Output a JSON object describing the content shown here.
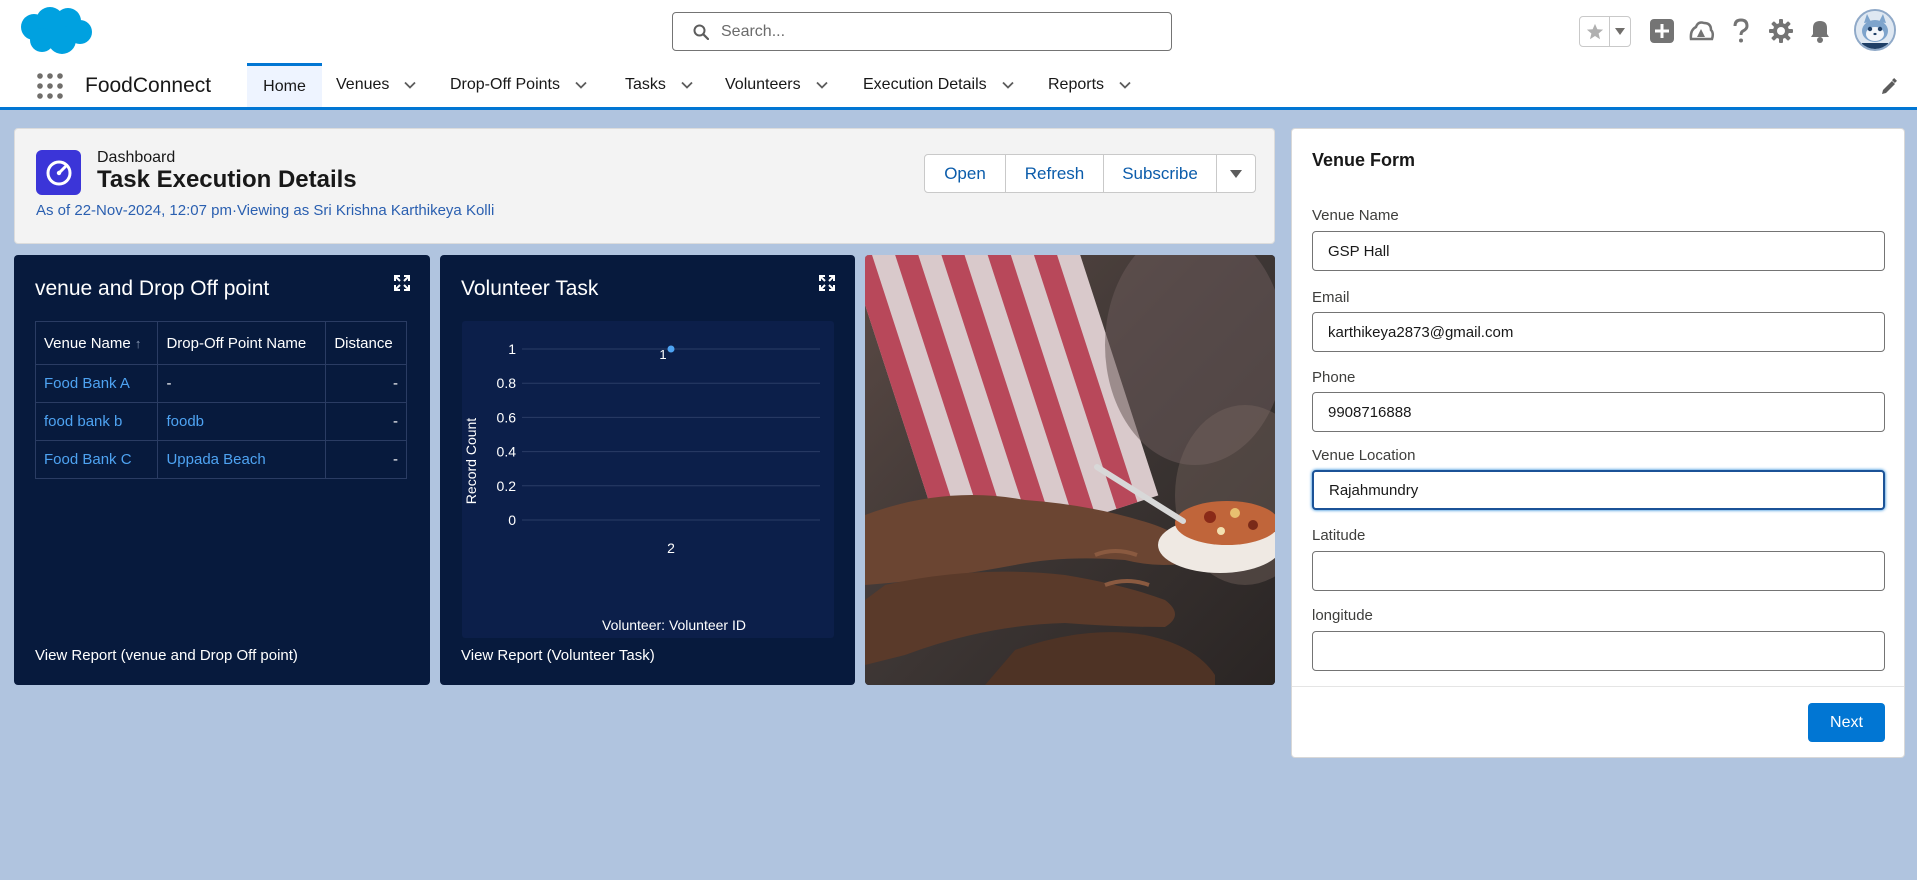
{
  "header": {
    "search_placeholder": "Search...",
    "icons": [
      "favorites-star-icon",
      "favorites-dropdown-icon",
      "global-actions-icon",
      "trailhead-icon",
      "help-icon",
      "setup-gear-icon",
      "notifications-bell-icon",
      "user-avatar"
    ]
  },
  "nav": {
    "app_name": "FoodConnect",
    "tabs": [
      {
        "label": "Home",
        "active": true
      },
      {
        "label": "Venues"
      },
      {
        "label": "Drop-Off Points"
      },
      {
        "label": "Tasks"
      },
      {
        "label": "Volunteers"
      },
      {
        "label": "Execution Details"
      },
      {
        "label": "Reports"
      }
    ]
  },
  "dashboard": {
    "type_label": "Dashboard",
    "title": "Task Execution Details",
    "meta": "As of 22-Nov-2024, 12:07 pm·Viewing as Sri Krishna Karthikeya Kolli",
    "actions": {
      "open": "Open",
      "refresh": "Refresh",
      "subscribe": "Subscribe"
    }
  },
  "widget_venue": {
    "title": "venue and Drop Off point",
    "columns": [
      "Venue Name",
      "Drop-Off Point Name",
      "Distance"
    ],
    "sort_indicator": "↑",
    "rows": [
      {
        "venue": "Food Bank A",
        "dropoff": "-",
        "distance": "-"
      },
      {
        "venue": "food bank b",
        "dropoff": "foodb",
        "distance": "-"
      },
      {
        "venue": "Food Bank C",
        "dropoff": "Uppada Beach",
        "distance": "-"
      }
    ],
    "footer": "View Report (venue and Drop Off point)"
  },
  "widget_volunteer": {
    "title": "Volunteer Task",
    "footer": "View Report (Volunteer Task)"
  },
  "chart_data": {
    "type": "scatter",
    "x": [
      "2"
    ],
    "y": [
      1
    ],
    "data_labels": [
      "1"
    ],
    "xlabel": "Volunteer: Volunteer ID",
    "ylabel": "Record Count",
    "yticks": [
      "0",
      "0.2",
      "0.4",
      "0.6",
      "0.8",
      "1"
    ],
    "ylim": [
      0,
      1
    ],
    "grid": true,
    "series_color": "#4ea3f2"
  },
  "form": {
    "title": "Venue Form",
    "fields": [
      {
        "label": "Venue Name",
        "value": "GSP Hall"
      },
      {
        "label": "Email",
        "value": "karthikeya2873@gmail.com"
      },
      {
        "label": "Phone",
        "value": "9908716888"
      },
      {
        "label": "Venue Location",
        "value": "Rajahmundry"
      },
      {
        "label": "Latitude",
        "value": ""
      },
      {
        "label": "longitude",
        "value": ""
      }
    ],
    "next_label": "Next"
  },
  "colors": {
    "brand_blue": "#0176d3",
    "page_background": "#b0c4df",
    "widget_background": "#071a3d",
    "link_blue": "#4ea3f2",
    "dashboard_icon": "#3b35d8"
  }
}
